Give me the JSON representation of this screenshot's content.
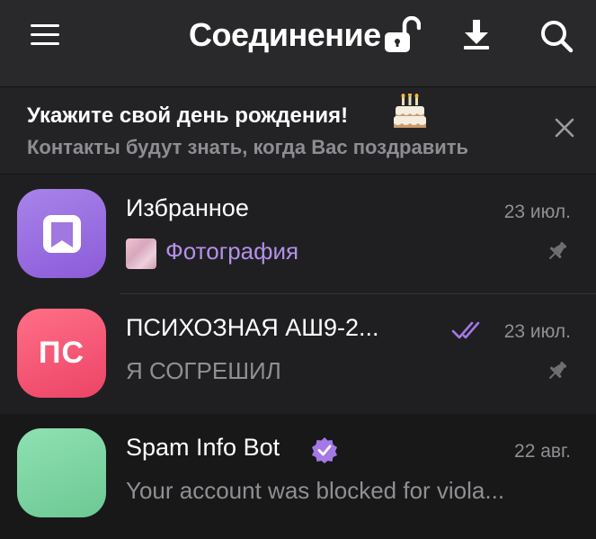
{
  "header": {
    "title": "Соединение",
    "icons": [
      "menu-icon",
      "unlock-icon",
      "download-icon",
      "search-icon"
    ]
  },
  "banner": {
    "title": "Укажите свой день рождения!",
    "subtitle": "Контакты будут знать, когда Вас поздравить",
    "icons": [
      "cake-icon",
      "close-icon"
    ]
  },
  "chats": [
    {
      "name": "Избранное",
      "date": "23 июл.",
      "message": "Фотография",
      "pinned": true,
      "avatar_color": "#9b6fe0"
    },
    {
      "name": "ПСИХОЗНАЯ АШ9-2...",
      "initials": "ПС",
      "date": "23 июл.",
      "message": "Я СОГРЕШИЛ",
      "pinned": true,
      "read": true,
      "avatar_color": "#f1566f"
    },
    {
      "name": "Spam Info Bot",
      "verified": true,
      "date": "22 авг.",
      "message": "Your account was blocked for viola...",
      "avatar_color": "#7fd4a3"
    }
  ],
  "colors": {
    "accent": "#a479e6",
    "topbar": "#29292b",
    "background": "#1f1f21",
    "secondary_text": "#8f8f94"
  }
}
